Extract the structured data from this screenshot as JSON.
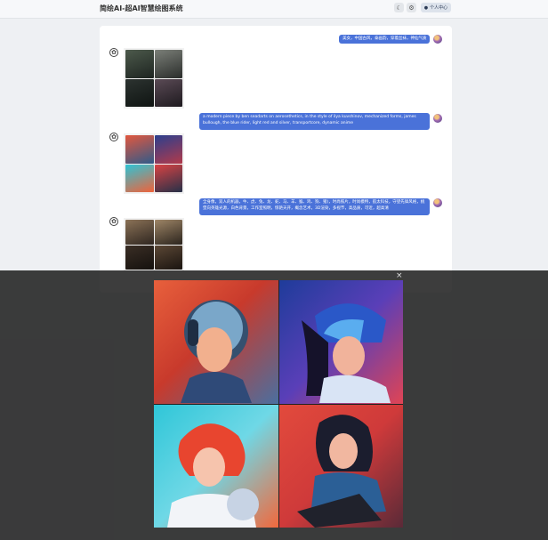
{
  "header": {
    "title": "简绘AI-超AI智慧绘图系统",
    "profile_label": "个人中心",
    "theme_icon": "moon-icon",
    "settings_icon": "gear-icon",
    "user_icon": "user-icon"
  },
  "chat": {
    "messages": [
      {
        "text": "美女，中国古风，泰画韵，穿着丝袜，神仙气质"
      },
      {
        "text": "a modern piece by ben seadarts on aerosethetics, in the style of ilya kuvshinov, mechanized forms, james bullough, the blue rider, light red and silver, transportcore, dynamic anime"
      },
      {
        "text": "全身像，双人的机器，牛、虎、兔、龙、蛇、马、羊、猴、鸡、狗、猪)，时尚照片，时尚模特，航太科技，守望先锋风格，桃堡向英雄光源，白色背景，工作室照明，惊艳天开，概念艺术，3D渲染，多视节，高品质，可近，超高清"
      }
    ]
  },
  "modal": {
    "close_glyph": "×"
  }
}
